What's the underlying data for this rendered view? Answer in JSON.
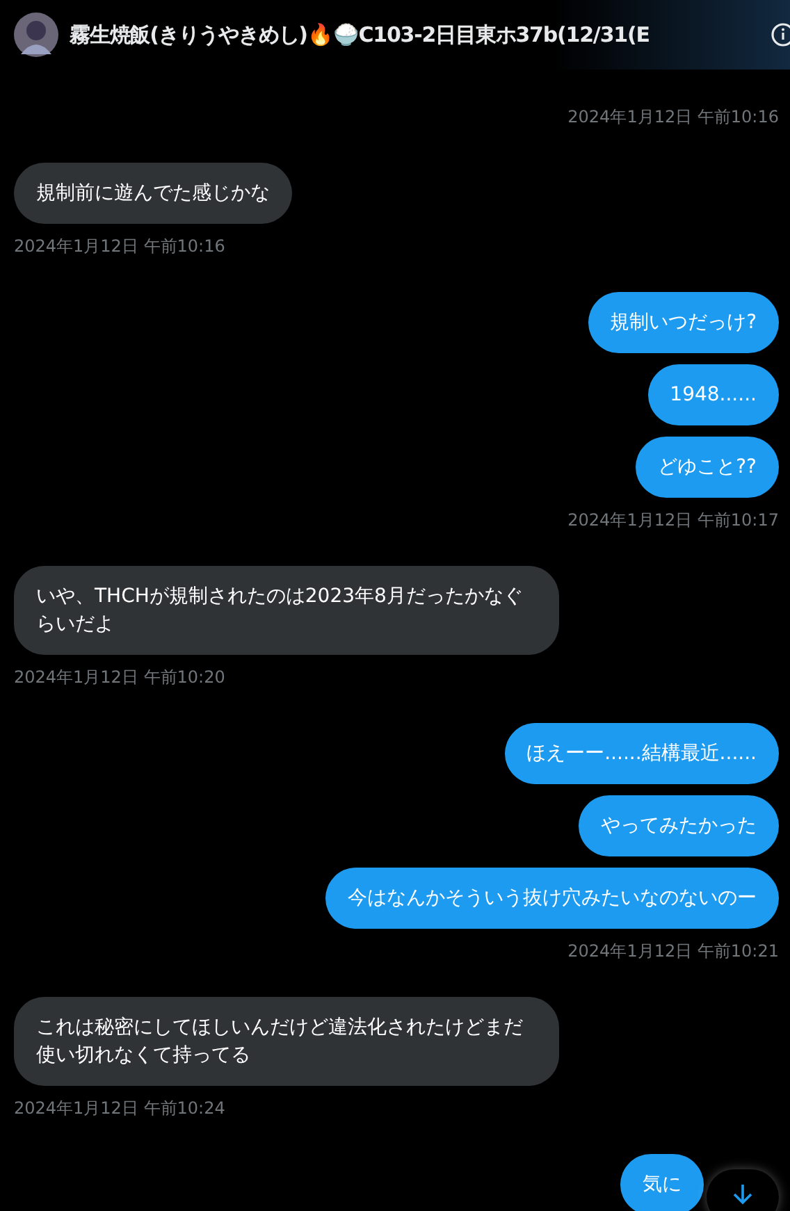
{
  "header": {
    "title": "霧生焼飯(きりうやきめし)🔥🍚C103-2日目東ホ37b(12/31(E"
  },
  "groups": [
    {
      "kind": "sent",
      "timestamp": "2024年1月12日 午前10:16"
    },
    {
      "kind": "received",
      "messages": [
        "規制前に遊んでた感じかな"
      ],
      "timestamp": "2024年1月12日 午前10:16"
    },
    {
      "kind": "sent",
      "messages": [
        "規制いつだっけ?",
        "1948......",
        "どゆこと??"
      ],
      "timestamp": "2024年1月12日 午前10:17"
    },
    {
      "kind": "received",
      "messages": [
        "いや、THCHが規制されたのは2023年8月だったかなぐらいだよ"
      ],
      "timestamp": "2024年1月12日 午前10:20"
    },
    {
      "kind": "sent",
      "messages": [
        "ほえーー......結構最近......",
        "やってみたかった",
        "今はなんかそういう抜け穴みたいなのないのー"
      ],
      "timestamp": "2024年1月12日 午前10:21"
    },
    {
      "kind": "received",
      "messages": [
        "これは秘密にしてほしいんだけど違法化されたけどまだ使い切れなくて持ってる"
      ],
      "timestamp": "2024年1月12日 午前10:24"
    },
    {
      "kind": "sent",
      "messages": [
        "気に"
      ]
    }
  ]
}
